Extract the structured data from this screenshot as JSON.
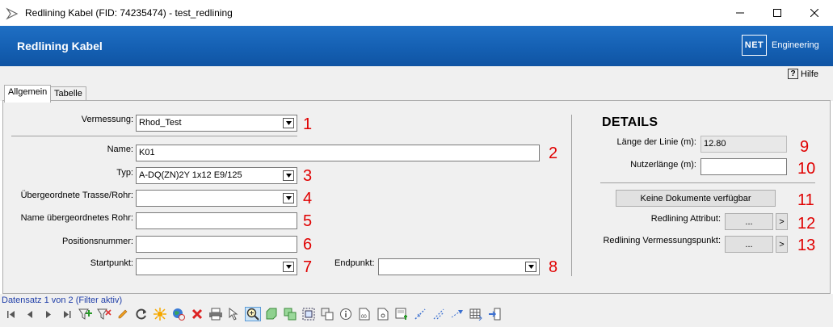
{
  "window": {
    "title": "Redlining Kabel (FID: 74235474) - test_redlining"
  },
  "header": {
    "title": "Redlining Kabel",
    "logo_text": "NET",
    "brand": "Engineering"
  },
  "help": {
    "label": "Hilfe"
  },
  "tabs": [
    {
      "label": "Allgemein",
      "active": true
    },
    {
      "label": "Tabelle",
      "active": false
    }
  ],
  "form": {
    "vermessung": {
      "label": "Vermessung:",
      "value": "Rhod_Test",
      "num": "1"
    },
    "name": {
      "label": "Name:",
      "value": "K01",
      "num": "2"
    },
    "typ": {
      "label": "Typ:",
      "value": "A-DQ(ZN)2Y 1x12 E9/125",
      "num": "3"
    },
    "trasse": {
      "label": "Übergeordnete Trasse/Rohr:",
      "value": "",
      "num": "4"
    },
    "rohr": {
      "label": "Name übergeordnetes Rohr:",
      "value": "",
      "num": "5"
    },
    "position": {
      "label": "Positionsnummer:",
      "value": "",
      "num": "6"
    },
    "startpunkt": {
      "label": "Startpunkt:",
      "value": "",
      "num": "7"
    },
    "endpunkt": {
      "label": "Endpunkt:",
      "value": "",
      "num": "8"
    }
  },
  "details": {
    "title": "DETAILS",
    "laenge": {
      "label": "Länge der Linie (m):",
      "value": "12.80",
      "num": "9"
    },
    "nutzer": {
      "label": "Nutzerlänge (m):",
      "value": "",
      "num": "10"
    },
    "dokumente": {
      "label": "Keine Dokumente verfügbar",
      "num": "11"
    },
    "attribut": {
      "label": "Redlining Attribut:",
      "btn": "...",
      "arrow": ">",
      "num": "12"
    },
    "vpunkt": {
      "label": "Redlining Vermessungspunkt:",
      "btn": "...",
      "arrow": ">",
      "num": "13"
    }
  },
  "status": {
    "record": "Datensatz 1 von 2 (Filter aktiv)"
  },
  "toolbar_icons": [
    "first-icon",
    "prev-icon",
    "next-icon",
    "last-icon",
    "add-filter-icon",
    "remove-filter-icon",
    "edit-icon",
    "refresh-icon",
    "highlight-icon",
    "globe-icon",
    "delete-icon",
    "print-icon",
    "select-icon",
    "zoom-icon",
    "shape-icon",
    "copy-icon",
    "select-area-icon",
    "duplicate-icon",
    "info-icon",
    "bulk-icon",
    "document-icon",
    "form-icon",
    "line-tool-icon",
    "dashed-line-icon",
    "snap-icon",
    "table-icon",
    "exit-icon"
  ]
}
